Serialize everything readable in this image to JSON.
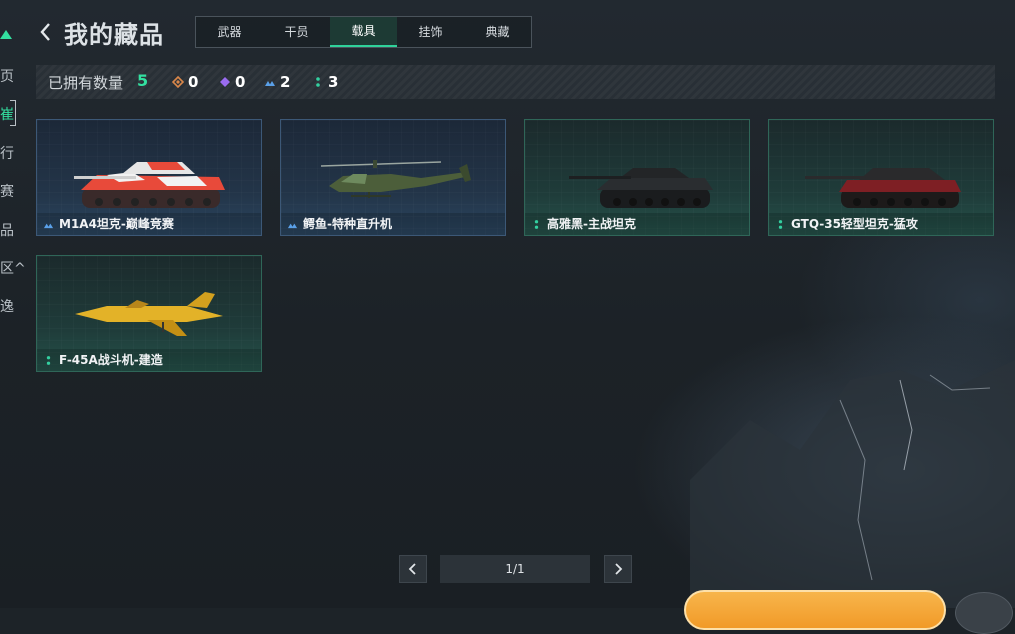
{
  "header": {
    "title": "我的藏品"
  },
  "tabs": [
    {
      "label": "武器"
    },
    {
      "label": "干员"
    },
    {
      "label": "载具",
      "active": true
    },
    {
      "label": "挂饰"
    },
    {
      "label": "典藏"
    }
  ],
  "sidebar": {
    "items": [
      {
        "label": "页"
      },
      {
        "label": "崔",
        "active": true
      },
      {
        "label": "行"
      },
      {
        "label": "赛"
      },
      {
        "label": "品"
      },
      {
        "label": "区^"
      },
      {
        "label": "逸"
      }
    ]
  },
  "owned": {
    "label": "已拥有数量",
    "total": "5",
    "rarities": [
      {
        "icon": "orange-diamond-icon",
        "color": "#d9874a",
        "count": "0"
      },
      {
        "icon": "purple-diamond-icon",
        "color": "#9a6cf0",
        "count": "0"
      },
      {
        "icon": "blue-chevron-icon",
        "color": "#5aa0e8",
        "count": "2"
      },
      {
        "icon": "green-dots-icon",
        "color": "#33d0a0",
        "count": "3"
      }
    ]
  },
  "items": [
    {
      "name": "M1A4坦克-巅峰竞赛",
      "rarity": "blue",
      "kind": "tank-red"
    },
    {
      "name": "鳄鱼-特种直升机",
      "rarity": "blue",
      "kind": "helicopter"
    },
    {
      "name": "高雅黑-主战坦克",
      "rarity": "green",
      "kind": "tank-black"
    },
    {
      "name": "GTQ-35轻型坦克-猛攻",
      "rarity": "green",
      "kind": "tank-dark-red"
    },
    {
      "name": "F-45A战斗机-建造",
      "rarity": "green",
      "kind": "jet-yellow"
    }
  ],
  "pagination": {
    "text": "1/1"
  }
}
